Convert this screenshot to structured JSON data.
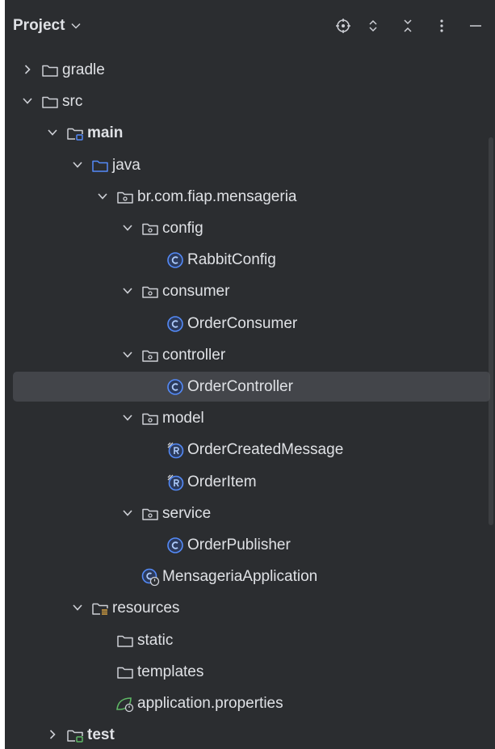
{
  "header": {
    "title": "Project",
    "actions": [
      "locate-icon",
      "expand-all-icon",
      "collapse-all-icon",
      "more-options-icon",
      "minimize-icon"
    ]
  },
  "tree": [
    {
      "label": "gradle",
      "level": 1,
      "expanded": false,
      "icon": "folder-icon",
      "bold": false
    },
    {
      "label": "src",
      "level": 1,
      "expanded": true,
      "icon": "folder-icon",
      "bold": false
    },
    {
      "label": "main",
      "level": 2,
      "expanded": true,
      "icon": "source-root-folder-icon",
      "bold": true
    },
    {
      "label": "java",
      "level": 3,
      "expanded": true,
      "icon": "source-folder-icon",
      "bold": false
    },
    {
      "label": "br.com.fiap.mensageria",
      "level": 4,
      "expanded": true,
      "icon": "package-icon",
      "bold": false
    },
    {
      "label": "config",
      "level": 5,
      "expanded": true,
      "icon": "package-icon",
      "bold": false
    },
    {
      "label": "RabbitConfig",
      "level": 6,
      "icon": "class-icon",
      "bold": false
    },
    {
      "label": "consumer",
      "level": 5,
      "expanded": true,
      "icon": "package-icon",
      "bold": false
    },
    {
      "label": "OrderConsumer",
      "level": 6,
      "icon": "class-icon",
      "bold": false
    },
    {
      "label": "controller",
      "level": 5,
      "expanded": true,
      "icon": "package-icon",
      "bold": false
    },
    {
      "label": "OrderController",
      "level": 6,
      "icon": "class-icon",
      "bold": false,
      "selected": true
    },
    {
      "label": "model",
      "level": 5,
      "expanded": true,
      "icon": "package-icon",
      "bold": false
    },
    {
      "label": "OrderCreatedMessage",
      "level": 6,
      "icon": "record-icon",
      "bold": false
    },
    {
      "label": "OrderItem",
      "level": 6,
      "icon": "record-icon",
      "bold": false
    },
    {
      "label": "service",
      "level": 5,
      "expanded": true,
      "icon": "package-icon",
      "bold": false
    },
    {
      "label": "OrderPublisher",
      "level": 6,
      "icon": "class-icon",
      "bold": false
    },
    {
      "label": "MensageriaApplication",
      "level": 5,
      "icon": "spring-boot-class-icon",
      "bold": false
    },
    {
      "label": "resources",
      "level": 3,
      "expanded": true,
      "icon": "resources-folder-icon",
      "bold": false
    },
    {
      "label": "static",
      "level": 4,
      "icon": "folder-icon",
      "bold": false
    },
    {
      "label": "templates",
      "level": 4,
      "icon": "folder-icon",
      "bold": false
    },
    {
      "label": "application.properties",
      "level": 4,
      "icon": "spring-properties-icon",
      "bold": false
    },
    {
      "label": "test",
      "level": 2,
      "expanded": false,
      "icon": "test-root-folder-icon",
      "bold": true
    }
  ],
  "colors": {
    "panel_bg": "#2b2d30",
    "text": "#dfe1e5",
    "selection": "#43454a",
    "accent_blue": "#548af7",
    "spring_green": "#5fb865",
    "icon_gray": "#ced0d6"
  }
}
